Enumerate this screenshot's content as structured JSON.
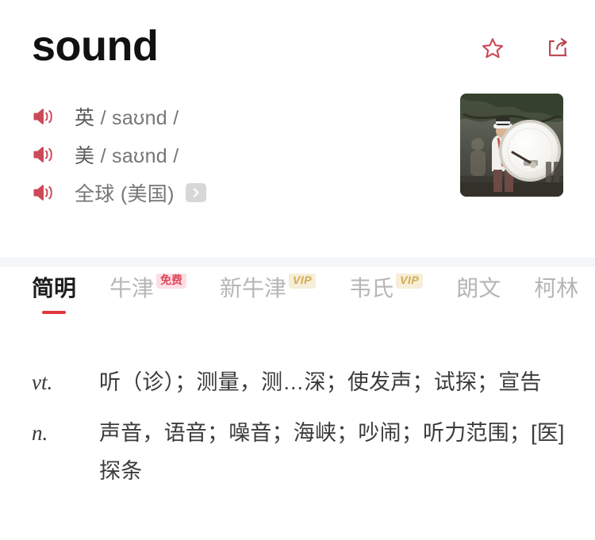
{
  "header": {
    "word": "sound",
    "actions": [
      {
        "name": "favorite-button",
        "icon": "star-icon",
        "color": "#cc4a58"
      },
      {
        "name": "share-button",
        "icon": "share-icon",
        "color": "#b8434f"
      }
    ],
    "thumbnail": {
      "name": "word-image",
      "alt": "marching band drummer with bass drum"
    },
    "pronunciations": [
      {
        "lang": "英",
        "ipa": "/ saʊnd /",
        "speaker_icon": "speaker-icon",
        "has_chevron": false
      },
      {
        "lang": "美",
        "ipa": "/ saʊnd /",
        "speaker_icon": "speaker-icon",
        "has_chevron": false
      },
      {
        "lang": "全球 (美国)",
        "ipa": "",
        "speaker_icon": "speaker-icon",
        "has_chevron": true,
        "chevron_icon": "chevron-right-icon"
      }
    ]
  },
  "tabs": [
    {
      "label": "简明",
      "active": true,
      "badge": null
    },
    {
      "label": "牛津",
      "active": false,
      "badge": {
        "text": "免费",
        "style": "free"
      }
    },
    {
      "label": "新牛津",
      "active": false,
      "badge": {
        "text": "VIP",
        "style": "vip"
      }
    },
    {
      "label": "韦氏",
      "active": false,
      "badge": {
        "text": "VIP",
        "style": "vip"
      }
    },
    {
      "label": "朗文",
      "active": false,
      "badge": null
    },
    {
      "label": "柯林",
      "active": false,
      "badge": null
    }
  ],
  "definitions": [
    {
      "pos": "vt.",
      "meaning": "听（诊）；测量，测…深；使发声；试探；宣告"
    },
    {
      "pos": "n.",
      "meaning": "声音，语音；噪音；海峡；吵闹；听力范围；[医] 探条"
    }
  ],
  "colors": {
    "accent_red": "#e0383e",
    "icon_red": "#cc4a58",
    "badge_free_bg": "#fbdfe3",
    "badge_free_text": "#dd4a5c",
    "badge_vip_bg": "#f6eed8",
    "badge_vip_text": "#d3ab50",
    "text_primary": "#1d1d1f",
    "text_muted": "#b6b6b6"
  }
}
